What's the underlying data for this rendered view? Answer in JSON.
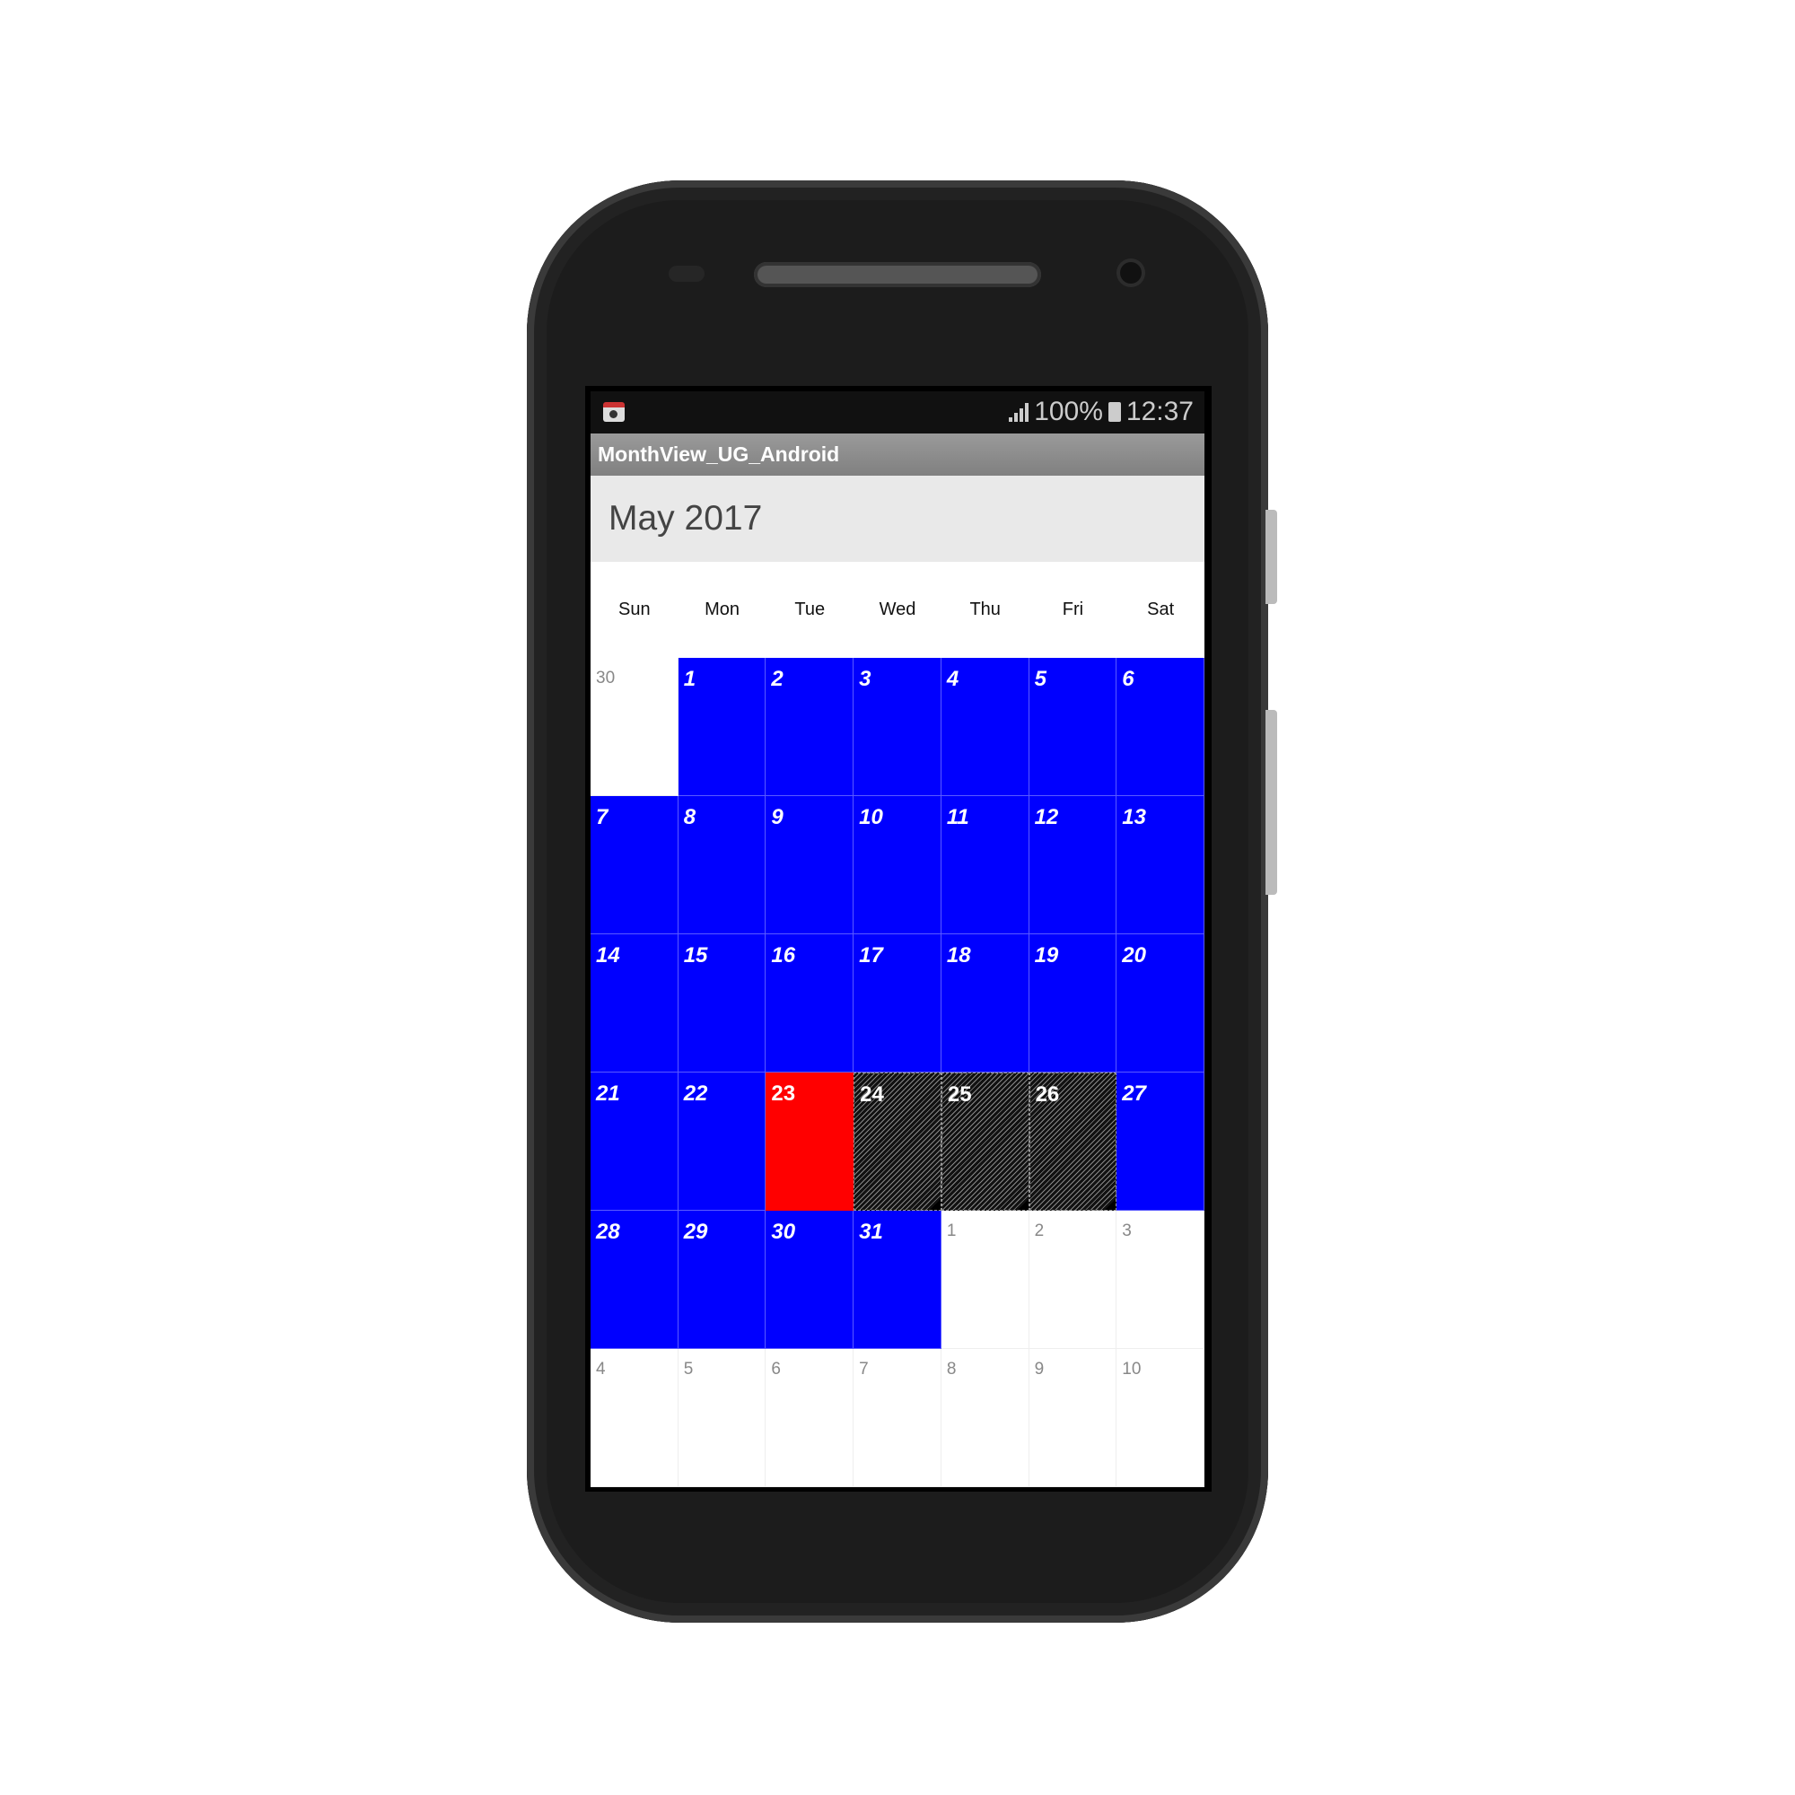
{
  "status_bar": {
    "signal_icon": "signal-icon",
    "battery_percent": "100%",
    "battery_icon": "battery-icon",
    "time": "12:37",
    "notification_icon": "camera-app-icon"
  },
  "app_title": "MonthView_UG_Android",
  "month_header": "May 2017",
  "day_names": [
    "Sun",
    "Mon",
    "Tue",
    "Wed",
    "Thu",
    "Fri",
    "Sat"
  ],
  "colors": {
    "month_cell": "#0000ff",
    "today": "#ff0000",
    "blackout": "hatched"
  },
  "weeks": [
    [
      {
        "d": "30",
        "t": "inactive"
      },
      {
        "d": "1",
        "t": "blue"
      },
      {
        "d": "2",
        "t": "blue"
      },
      {
        "d": "3",
        "t": "blue"
      },
      {
        "d": "4",
        "t": "blue"
      },
      {
        "d": "5",
        "t": "blue"
      },
      {
        "d": "6",
        "t": "blue"
      }
    ],
    [
      {
        "d": "7",
        "t": "blue"
      },
      {
        "d": "8",
        "t": "blue"
      },
      {
        "d": "9",
        "t": "blue"
      },
      {
        "d": "10",
        "t": "blue"
      },
      {
        "d": "11",
        "t": "blue"
      },
      {
        "d": "12",
        "t": "blue"
      },
      {
        "d": "13",
        "t": "blue"
      }
    ],
    [
      {
        "d": "14",
        "t": "blue"
      },
      {
        "d": "15",
        "t": "blue"
      },
      {
        "d": "16",
        "t": "blue"
      },
      {
        "d": "17",
        "t": "blue"
      },
      {
        "d": "18",
        "t": "blue"
      },
      {
        "d": "19",
        "t": "blue"
      },
      {
        "d": "20",
        "t": "blue"
      }
    ],
    [
      {
        "d": "21",
        "t": "blue"
      },
      {
        "d": "22",
        "t": "blue"
      },
      {
        "d": "23",
        "t": "red"
      },
      {
        "d": "24",
        "t": "blackout"
      },
      {
        "d": "25",
        "t": "blackout"
      },
      {
        "d": "26",
        "t": "blackout"
      },
      {
        "d": "27",
        "t": "blue"
      }
    ],
    [
      {
        "d": "28",
        "t": "blue"
      },
      {
        "d": "29",
        "t": "blue"
      },
      {
        "d": "30",
        "t": "blue"
      },
      {
        "d": "31",
        "t": "blue"
      },
      {
        "d": "1",
        "t": "inactive"
      },
      {
        "d": "2",
        "t": "inactive"
      },
      {
        "d": "3",
        "t": "inactive"
      }
    ],
    [
      {
        "d": "4",
        "t": "inactive"
      },
      {
        "d": "5",
        "t": "inactive"
      },
      {
        "d": "6",
        "t": "inactive"
      },
      {
        "d": "7",
        "t": "inactive"
      },
      {
        "d": "8",
        "t": "inactive"
      },
      {
        "d": "9",
        "t": "inactive"
      },
      {
        "d": "10",
        "t": "inactive"
      }
    ]
  ]
}
